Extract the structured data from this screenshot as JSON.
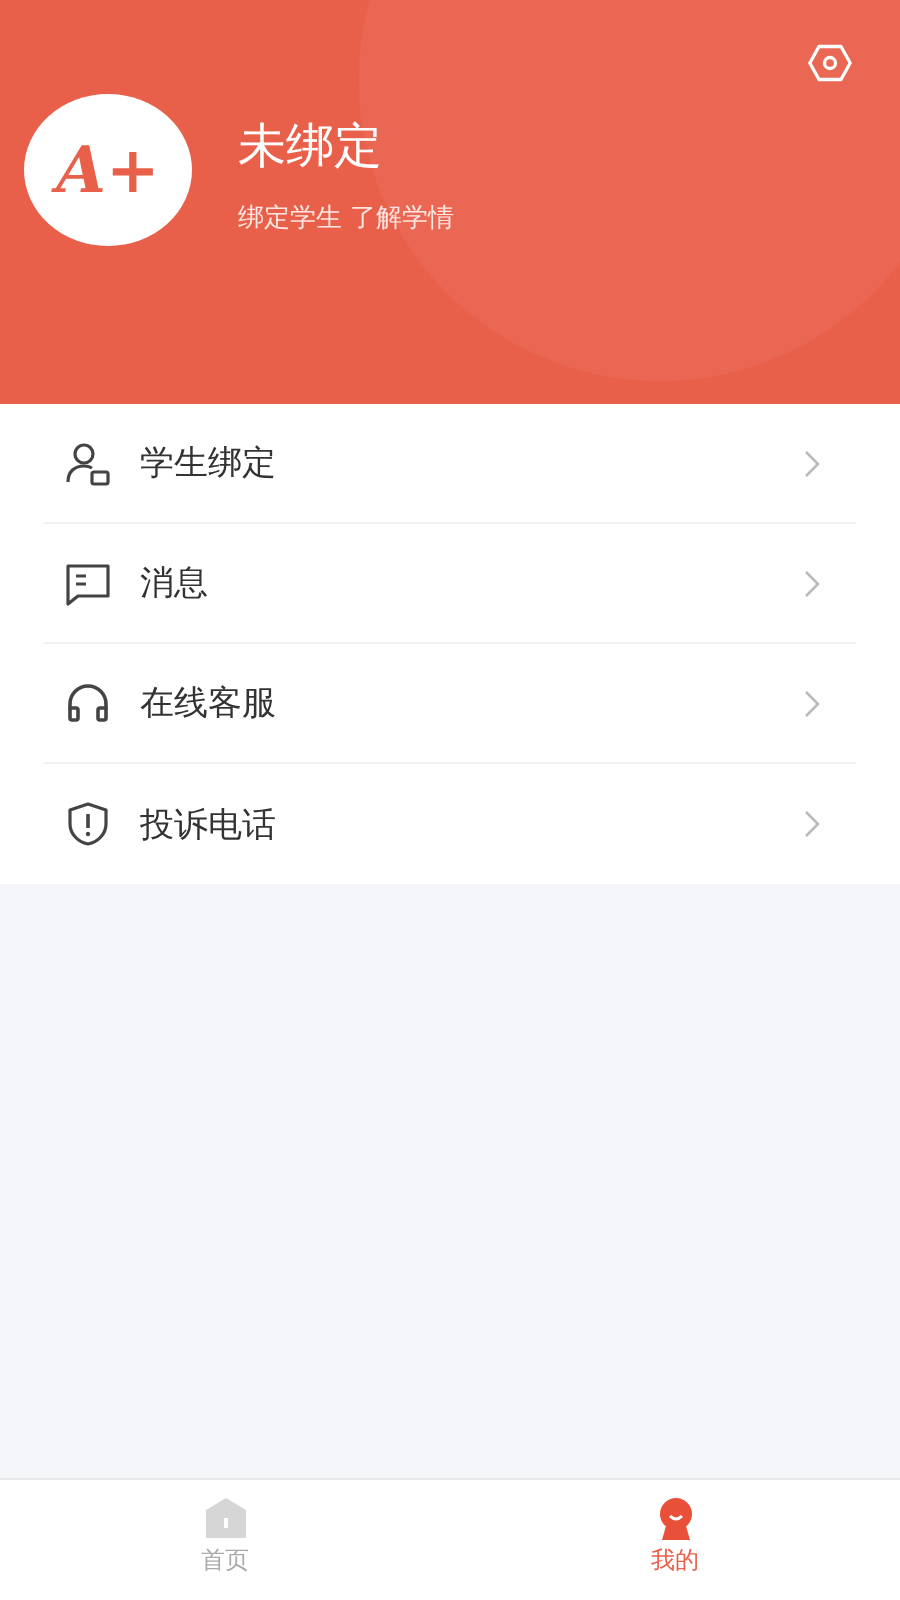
{
  "header": {
    "logo_text": "A+",
    "title": "未绑定",
    "subtitle": "绑定学生 了解学情"
  },
  "menu": [
    {
      "kind": "student",
      "label": "学生绑定"
    },
    {
      "kind": "message",
      "label": "消息"
    },
    {
      "kind": "support",
      "label": "在线客服"
    },
    {
      "kind": "complaint",
      "label": "投诉电话"
    }
  ],
  "tabs": [
    {
      "kind": "home",
      "label": "首页",
      "selected": false
    },
    {
      "kind": "mine",
      "label": "我的",
      "selected": true
    }
  ]
}
